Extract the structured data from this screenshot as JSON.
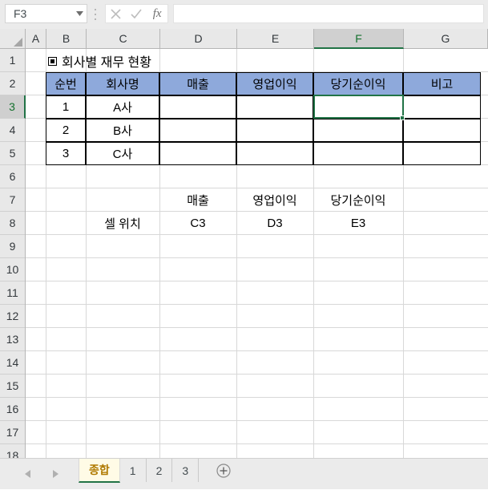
{
  "formula_bar": {
    "name_box_value": "F3",
    "formula_value": "",
    "formula_placeholder": "",
    "cancel_label": "✕",
    "confirm_label": "✓",
    "fx_label": "fx"
  },
  "grid": {
    "columns": [
      "A",
      "B",
      "C",
      "D",
      "E",
      "F",
      "G"
    ],
    "selected_column": "F",
    "rows": [
      "1",
      "2",
      "3",
      "4",
      "5",
      "6",
      "7",
      "8",
      "9",
      "10",
      "11",
      "12",
      "13",
      "14",
      "15",
      "16",
      "17",
      "18"
    ],
    "selected_row": "3",
    "selected_cell": "F3"
  },
  "sheet_content": {
    "title": "회사별 재무 현황",
    "title_marker": "■",
    "table": {
      "headers": [
        "순번",
        "회사명",
        "매출",
        "영업이익",
        "당기순이익",
        "비고"
      ],
      "rows": [
        [
          "1",
          "A사",
          "",
          "",
          "",
          ""
        ],
        [
          "2",
          "B사",
          "",
          "",
          "",
          ""
        ],
        [
          "3",
          "C사",
          "",
          "",
          "",
          ""
        ]
      ]
    },
    "note_block": {
      "label": "셀 위치",
      "column_labels": [
        "매출",
        "영업이익",
        "당기순이익"
      ],
      "values": [
        "C3",
        "D3",
        "E3"
      ]
    }
  },
  "tab_bar": {
    "tabs": [
      {
        "label": "종합",
        "active": true
      },
      {
        "label": "1",
        "active": false
      },
      {
        "label": "2",
        "active": false
      },
      {
        "label": "3",
        "active": false
      }
    ],
    "add_sheet_label": "+"
  },
  "colors": {
    "header_fill": "#8ea9db",
    "selection": "#217346",
    "active_tab_text": "#b07a00",
    "header_strip": "#e8e8e8"
  }
}
